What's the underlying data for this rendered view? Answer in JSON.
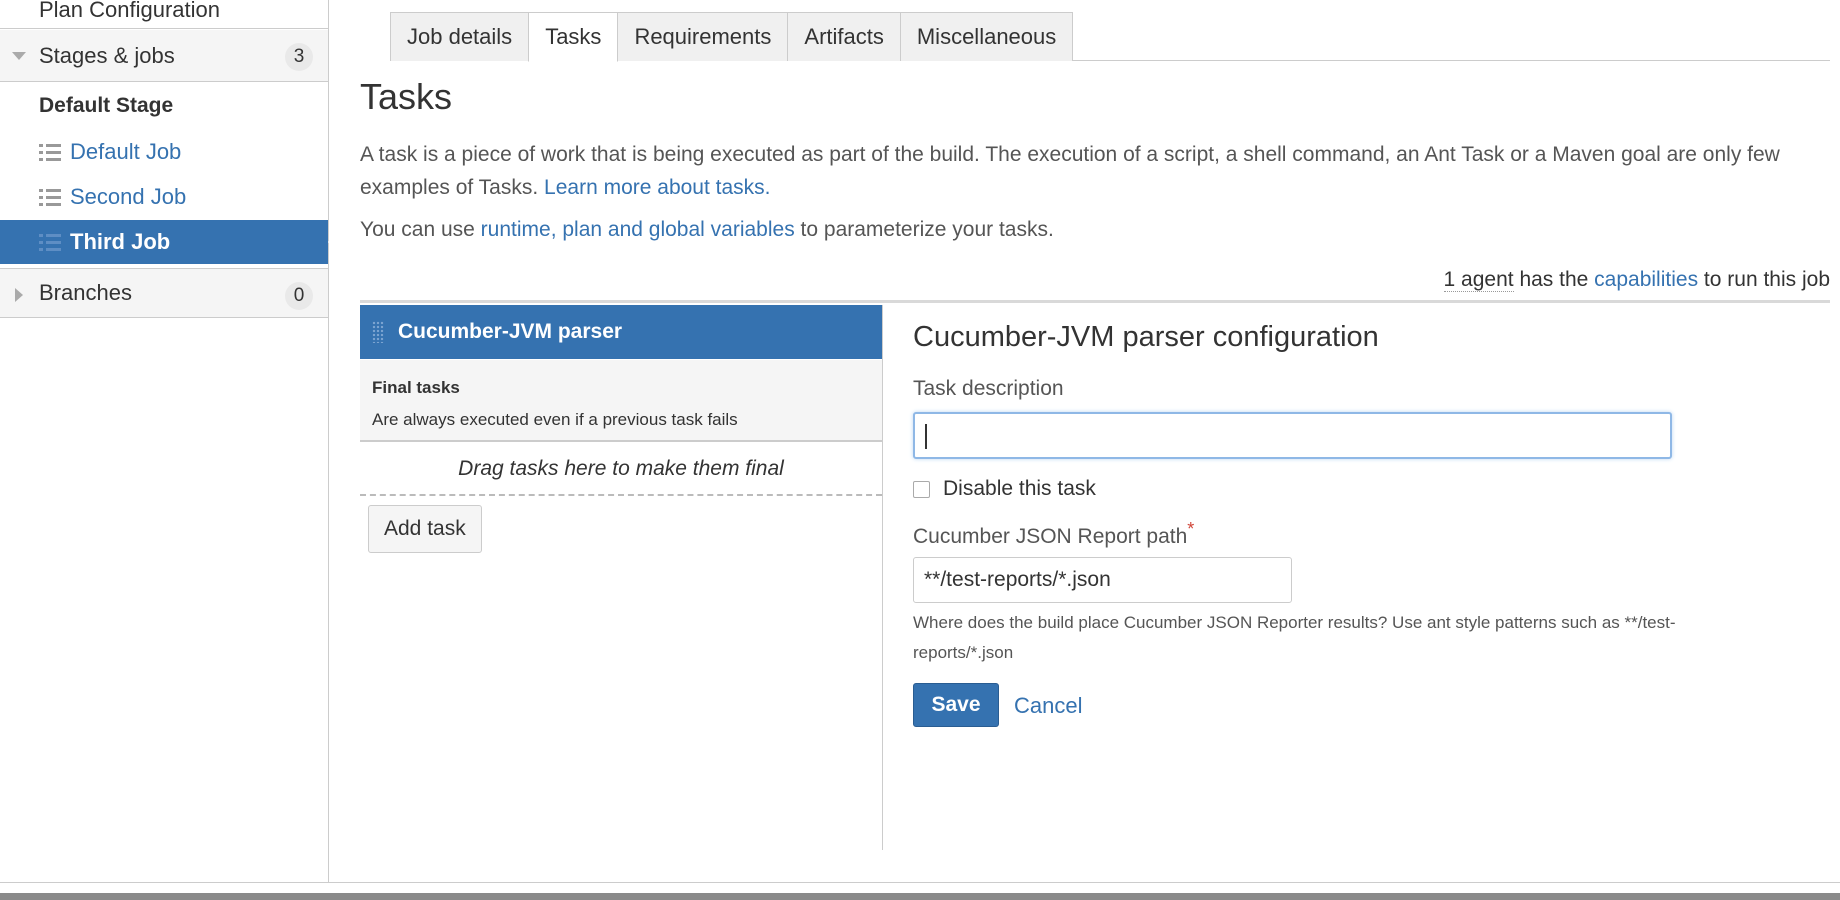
{
  "sidebar": {
    "plan_configuration": "Plan Configuration",
    "stages_label": "Stages & jobs",
    "stages_count": "3",
    "default_stage": "Default Stage",
    "jobs": [
      {
        "label": "Default Job"
      },
      {
        "label": "Second Job"
      },
      {
        "label": "Third Job"
      }
    ],
    "branches_label": "Branches",
    "branches_count": "0"
  },
  "tabs": [
    {
      "label": "Job details"
    },
    {
      "label": "Tasks"
    },
    {
      "label": "Requirements"
    },
    {
      "label": "Artifacts"
    },
    {
      "label": "Miscellaneous"
    }
  ],
  "main": {
    "title": "Tasks",
    "intro_text": "A task is a piece of work that is being executed as part of the build. The execution of a script, a shell command, an Ant Task or a Maven goal are only few examples of Tasks.",
    "learn_more_link": "Learn more about tasks.",
    "vars_prefix": "You can use",
    "vars_link": "runtime, plan and global variables",
    "vars_suffix": "to parameterize your tasks.",
    "agent_count": "1 agent",
    "agent_mid": "has the",
    "capabilities_link": "capabilities",
    "agent_suffix": "to run this job"
  },
  "task_list": {
    "selected_task": "Cucumber-JVM parser",
    "final_title": "Final tasks",
    "final_desc": "Are always executed even if a previous task fails",
    "drag_hint": "Drag tasks here to make them final",
    "add_task": "Add task"
  },
  "config": {
    "title": "Cucumber-JVM parser configuration",
    "task_desc_label": "Task description",
    "task_desc_value": "",
    "disable_label": "Disable this task",
    "path_label": "Cucumber JSON Report path",
    "required_mark": "*",
    "path_value": "**/test-reports/*.json",
    "help_text": "Where does the build place Cucumber JSON Reporter results? Use ant style patterns such as **/test-reports/*.json",
    "save": "Save",
    "cancel": "Cancel"
  }
}
